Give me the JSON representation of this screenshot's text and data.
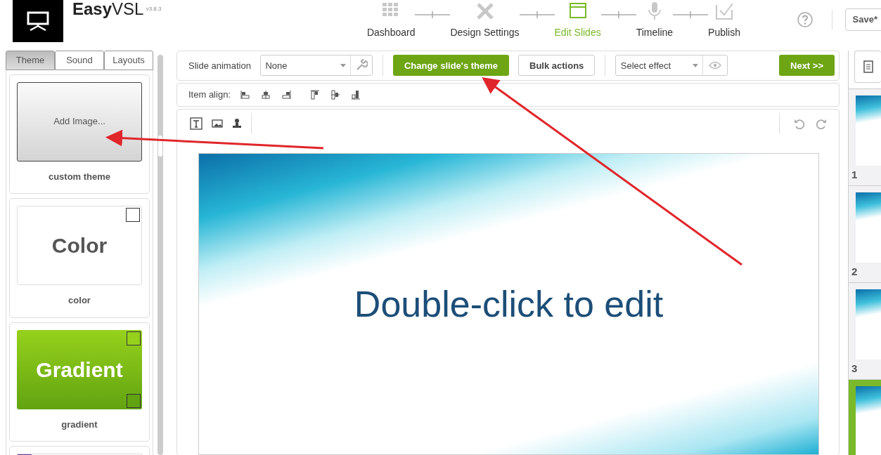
{
  "header": {
    "logo": "**Easy**VSL",
    "version": "v3.8.3",
    "save": "Save*"
  },
  "steps": [
    {
      "label": "Dashboard",
      "selected": false
    },
    {
      "label": "Design Settings",
      "selected": false
    },
    {
      "label": "Edit Slides",
      "selected": true
    },
    {
      "label": "Timeline",
      "selected": false
    },
    {
      "label": "Publish",
      "selected": false
    }
  ],
  "left_tabs": [
    {
      "label": "Theme",
      "selected": true
    },
    {
      "label": "Sound",
      "selected": false
    },
    {
      "label": "Layouts",
      "selected": false
    }
  ],
  "themes": [
    {
      "kind": "image",
      "preview": "Add Image...",
      "caption": "custom theme"
    },
    {
      "kind": "color",
      "preview": "Color",
      "caption": "color"
    },
    {
      "kind": "gradient",
      "preview": "Gradient",
      "caption": "gradient"
    },
    {
      "kind": "partial"
    }
  ],
  "toolbar": {
    "animation_label": "Slide animation",
    "animation_value": "None",
    "change_theme": "Change slide's theme",
    "bulk_actions": "Bulk actions",
    "effect_placeholder": "Select effect",
    "next": "Next >>"
  },
  "align": {
    "label": "Item align:"
  },
  "slide": {
    "text": "Double-click to edit"
  },
  "thumbnails": [
    {
      "number": "1",
      "selected": false
    },
    {
      "number": "2",
      "selected": false
    },
    {
      "number": "3",
      "selected": false
    },
    {
      "selected": true
    }
  ]
}
